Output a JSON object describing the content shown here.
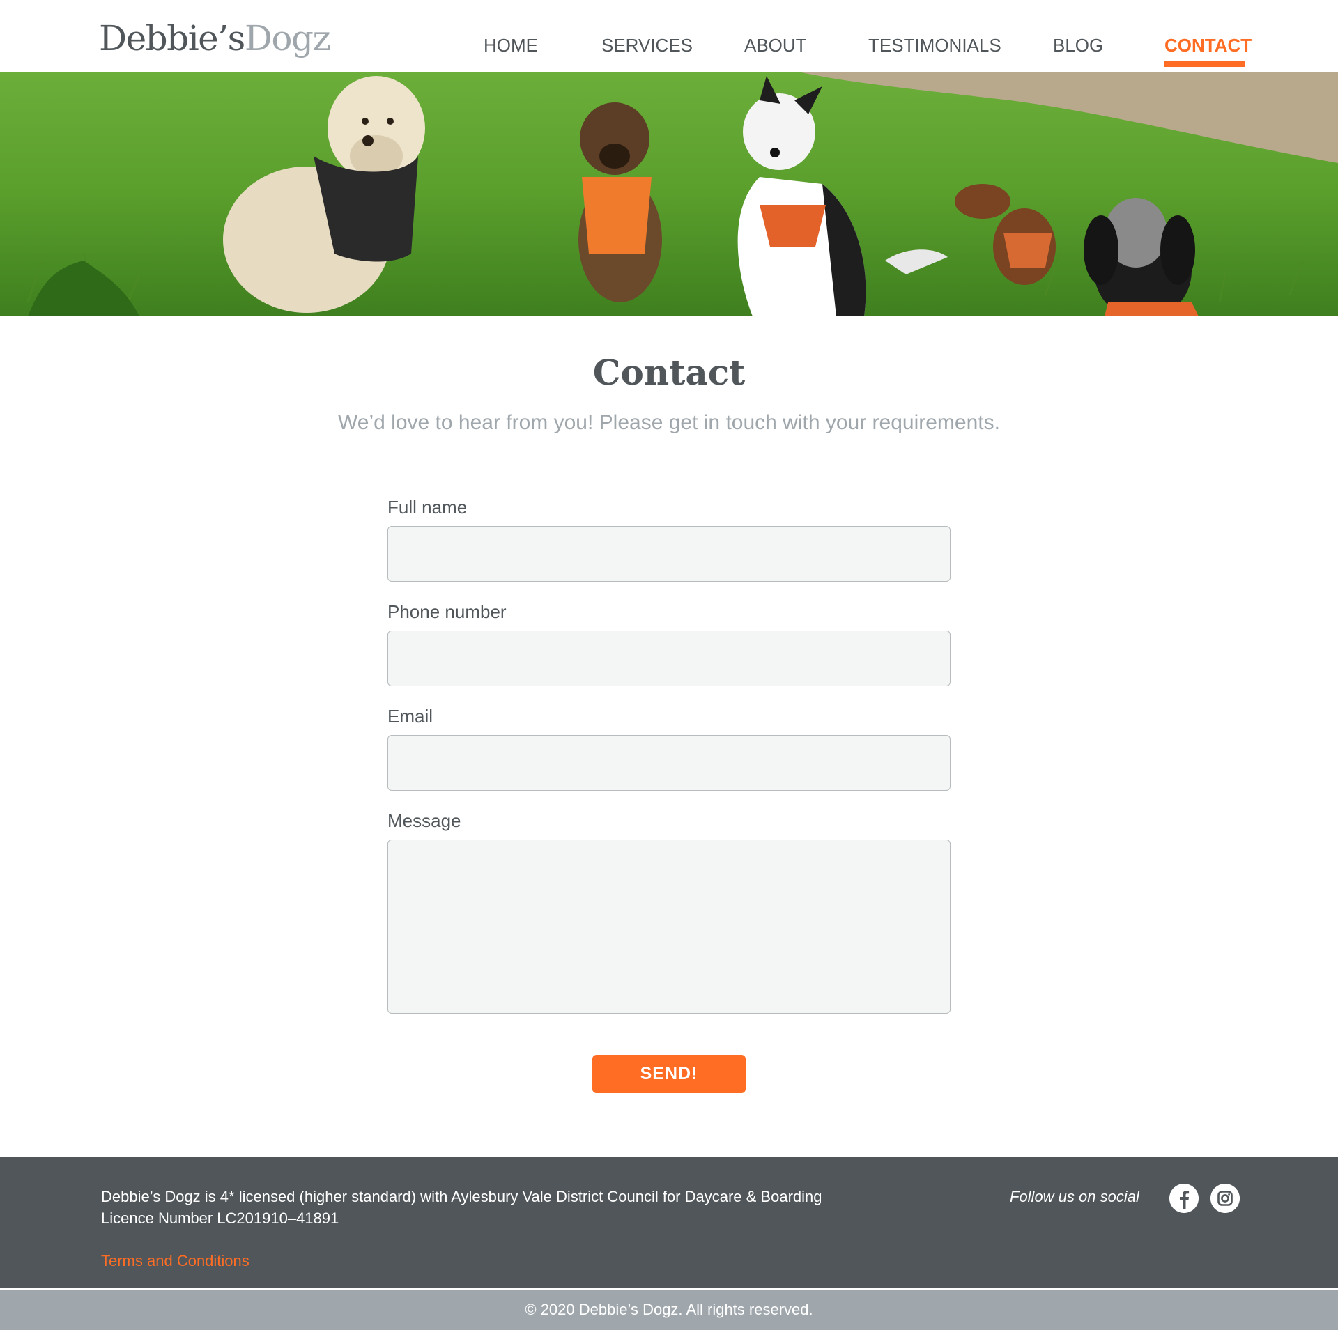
{
  "brand": {
    "name_part1": "Debbie’s",
    "name_part2": "Dogz"
  },
  "nav": {
    "items": [
      {
        "label": "HOME"
      },
      {
        "label": "SERVICES"
      },
      {
        "label": "ABOUT"
      },
      {
        "label": "TESTIMONIALS"
      },
      {
        "label": "BLOG"
      },
      {
        "label": "CONTACT",
        "active": true
      }
    ]
  },
  "hero": {
    "image": "dogs-on-grass-photo"
  },
  "main": {
    "title": "Contact",
    "subtitle": "We’d love to hear from you! Please get in touch with your requirements."
  },
  "form": {
    "full_name_label": "Full name",
    "full_name_value": "",
    "phone_label": "Phone number",
    "phone_value": "",
    "email_label": "Email",
    "email_value": "",
    "message_label": "Message",
    "message_value": "",
    "submit_label": "SEND!"
  },
  "footer": {
    "licence_line1": "Debbie’s Dogz is 4* licensed (higher standard) with Aylesbury Vale District Council for Daycare & Boarding",
    "licence_line2": "Licence Number LC201910–41891",
    "terms_link": "Terms and Conditions",
    "follow_text": "Follow us on social",
    "social_icons": [
      "facebook-icon",
      "instagram-icon"
    ],
    "copyright": "© 2020 Debbie’s Dogz. All rights reserved."
  },
  "colors": {
    "accent": "#ff6d24",
    "text": "#50565a",
    "muted": "#9fa7ac",
    "footer_bg": "#50565a",
    "copyright_bg": "#9fa7ac",
    "input_bg": "#f4f6f5"
  }
}
